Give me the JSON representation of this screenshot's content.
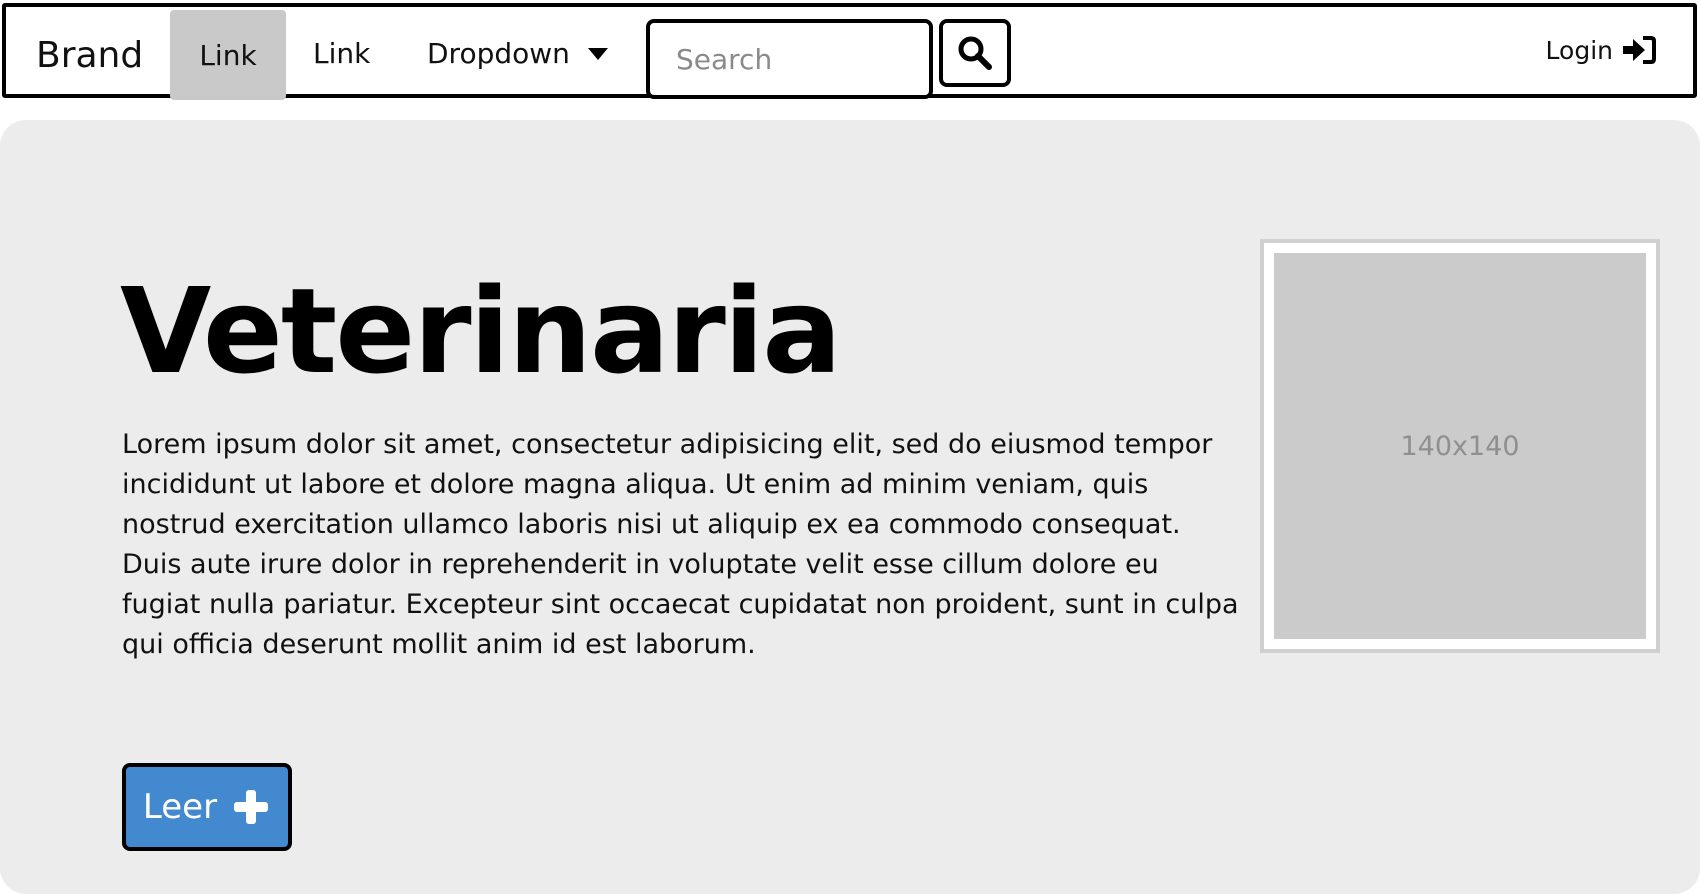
{
  "navbar": {
    "brand": "Brand",
    "links": [
      {
        "label": "Link",
        "active": true
      },
      {
        "label": "Link",
        "active": false
      }
    ],
    "dropdown_label": "Dropdown",
    "search": {
      "placeholder": "Search",
      "value": ""
    },
    "search_icon": "magnifier-icon",
    "login_label": "Login",
    "login_icon": "sign-in-icon"
  },
  "jumbotron": {
    "title": "Veterinaria",
    "text": "Lorem ipsum dolor sit amet, consectetur adipisicing elit, sed do eiusmod tempor incididunt ut labore et dolore magna aliqua. Ut enim ad minim veniam, quis nostrud exercitation ullamco laboris nisi ut aliquip ex ea commodo consequat. Duis aute irure dolor in reprehenderit in voluptate velit esse cillum dolore eu fugiat nulla pariatur. Excepteur sint occaecat cupidatat non proident, sunt in culpa qui officia deserunt mollit anim id est laborum.",
    "image_placeholder": "140x140",
    "button_label": "Leer",
    "button_icon": "plus-icon"
  },
  "colors": {
    "button_blue": "#4389cf",
    "jumbotron_bg": "#ececec",
    "active_link_bg": "#c9c9c9",
    "placeholder_bg": "#cbcbcb"
  }
}
